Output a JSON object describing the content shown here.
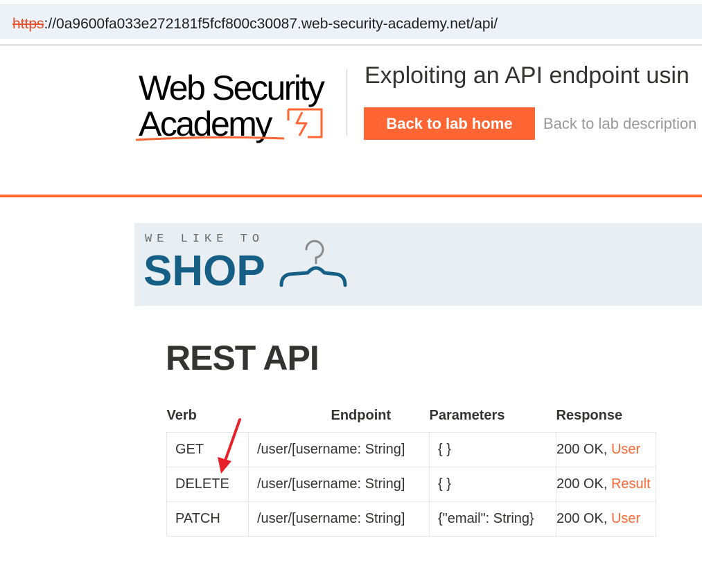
{
  "browser": {
    "url_scheme": "https",
    "url_rest": "://0a9600fa033e272181f5fcf800c30087.web-security-academy.net/api/"
  },
  "lab_header": {
    "logo_line1": "Web Security",
    "logo_line2": "Academy",
    "title": "Exploiting an API endpoint usin",
    "back_home_label": "Back to lab home",
    "back_description_label": "Back to lab description"
  },
  "banner": {
    "tagline": "WE LIKE TO",
    "brand": "SHOP"
  },
  "api": {
    "title": "REST API",
    "columns": [
      "Verb",
      "Endpoint",
      "Parameters",
      "Response"
    ],
    "rows": [
      {
        "verb": "GET",
        "endpoint": "/user/[username: String]",
        "params": "{ }",
        "status": "200 OK, ",
        "type": "User"
      },
      {
        "verb": "DELETE",
        "endpoint": "/user/[username: String]",
        "params": "{ }",
        "status": "200 OK, ",
        "type": "Result"
      },
      {
        "verb": "PATCH",
        "endpoint": "/user/[username: String]",
        "params": "{\"email\": String}",
        "status": "200 OK, ",
        "type": "User"
      }
    ]
  },
  "colors": {
    "accent": "#ff6633",
    "shop_blue": "#155f86",
    "banner_bg": "#e9eef2",
    "annotation_red": "#e8202a"
  },
  "icons": {
    "logo_mark": "lightning-box-icon",
    "hanger": "hanger-icon",
    "annotation": "red-arrow-icon"
  }
}
